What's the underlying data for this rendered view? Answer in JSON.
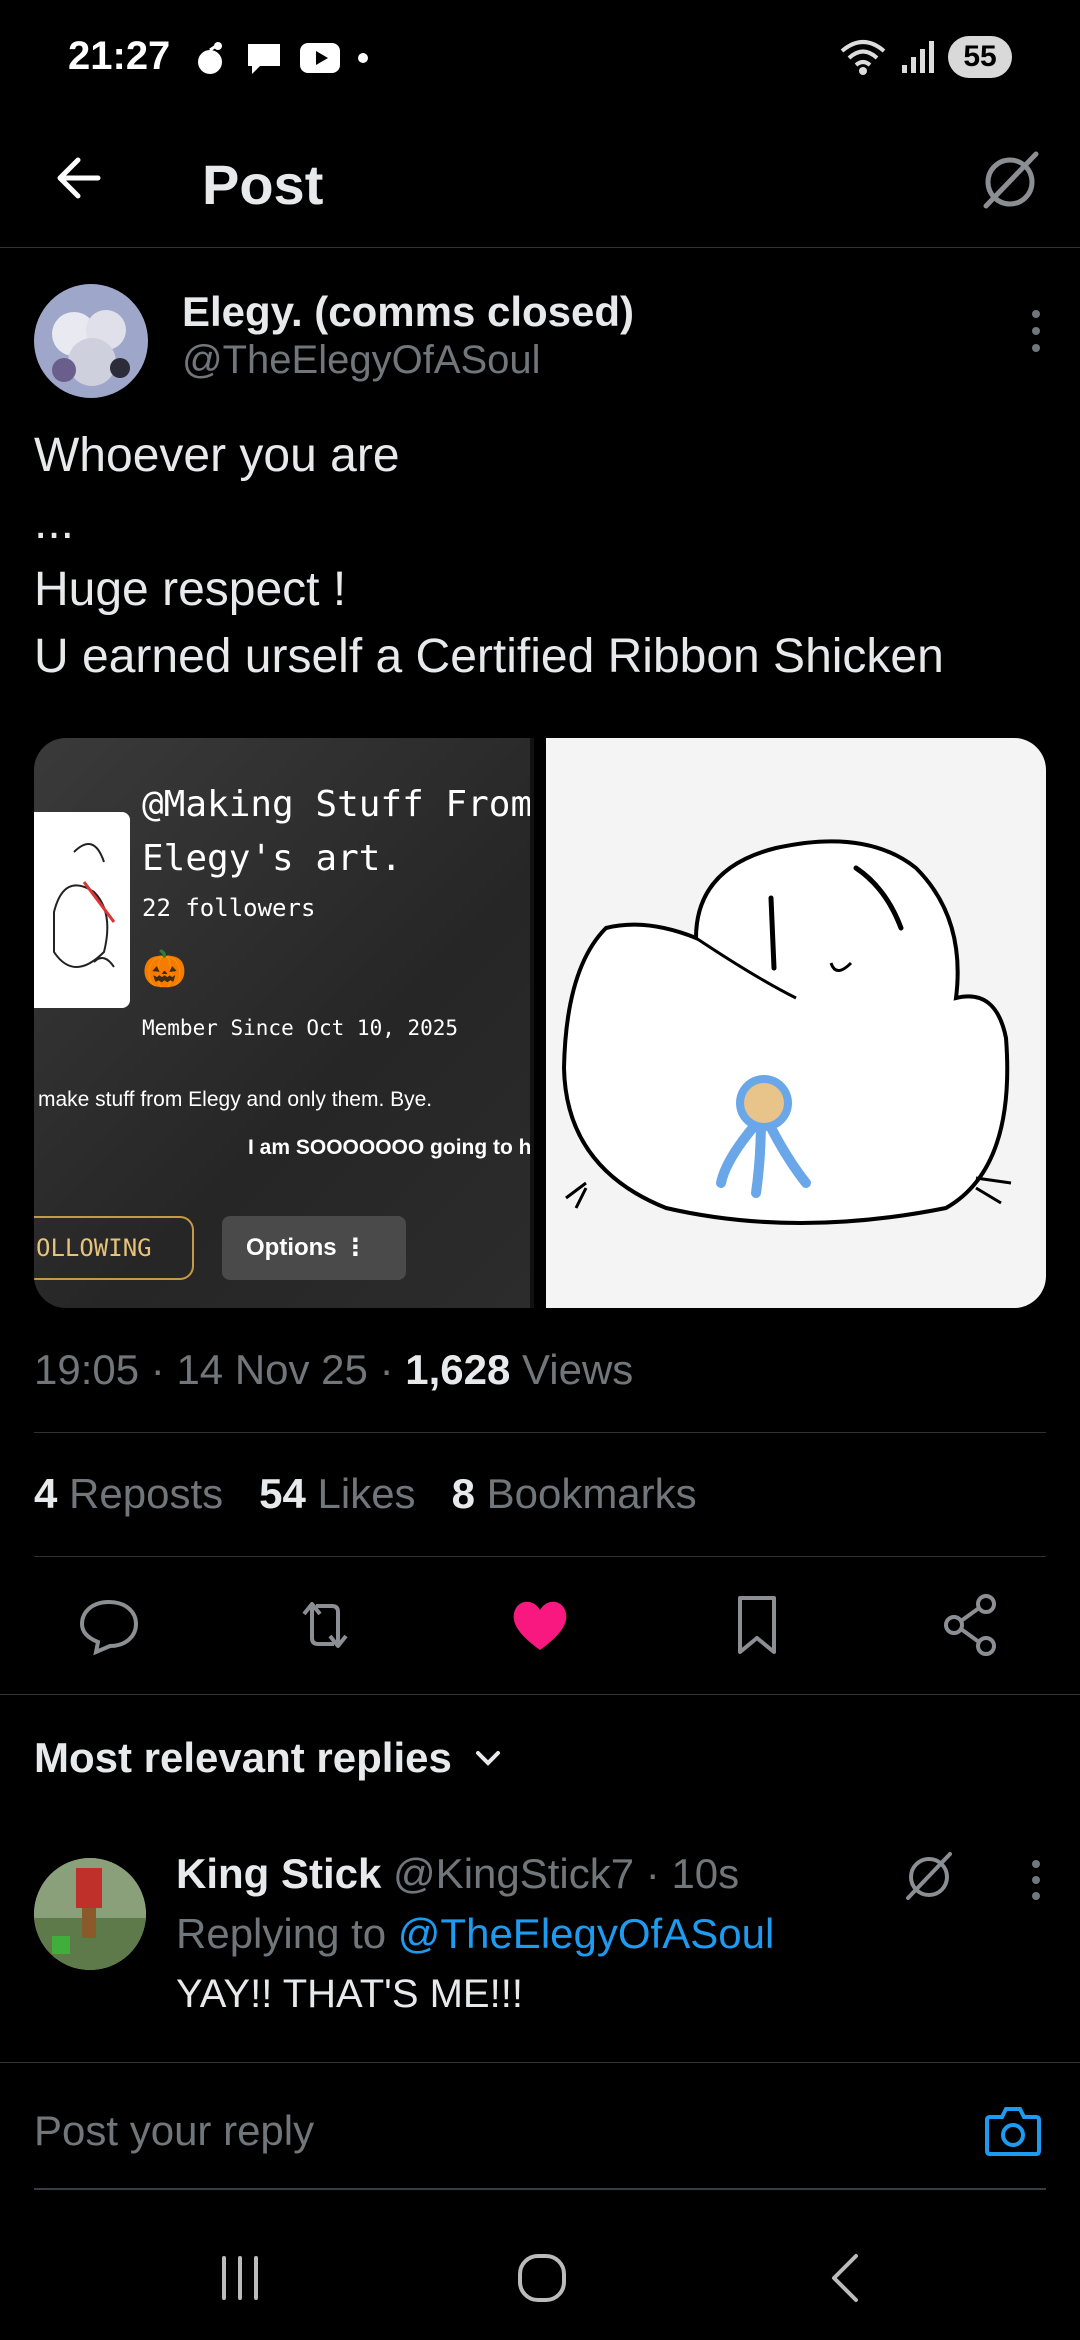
{
  "status_bar": {
    "time": "21:27",
    "battery": "55",
    "network_label": "5"
  },
  "header": {
    "title": "Post"
  },
  "post": {
    "author_name": "Elegy. (comms closed)",
    "author_handle": "@TheElegyOfASoul",
    "text": "Whoever you are\n...\nHuge respect !\nU earned urself a Certified Ribbon Shicken",
    "media_left": {
      "title": "@Making Stuff From\nElegy's art.",
      "followers": "22 followers",
      "member_since": "Member Since Oct 10, 2025",
      "bio": "make stuff from Elegy and only them. Bye.",
      "bio2": "I am SOOOOOOO going to h",
      "follow_label": "OLLOWING",
      "options_label": "Options"
    },
    "time": "19:05",
    "date": "14 Nov 25",
    "views_count": "1,628",
    "views_label": "Views",
    "reposts_count": "4",
    "reposts_label": "Reposts",
    "likes_count": "54",
    "likes_label": "Likes",
    "bookmarks_count": "8",
    "bookmarks_label": "Bookmarks"
  },
  "replies": {
    "sort_label": "Most relevant replies",
    "items": [
      {
        "name": "King Stick",
        "handle": "@KingStick7",
        "time": "10s",
        "replying_to_label": "Replying to",
        "replying_to_handle": "@TheElegyOfASoul",
        "text": "YAY!! THAT'S ME!!!"
      }
    ]
  },
  "reply_box": {
    "placeholder": "Post your reply"
  },
  "colors": {
    "background": "#000000",
    "text_primary": "#e7e9ea",
    "text_secondary": "#71767b",
    "link": "#1d9bf0",
    "like": "#f91880",
    "divider": "#2f3336"
  }
}
